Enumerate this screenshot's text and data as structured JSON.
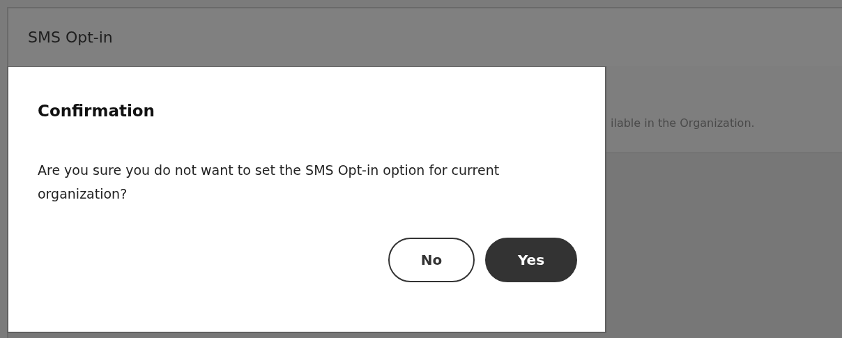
{
  "page": {
    "title": "SMS Opt-in",
    "description": "ilable in the Organization."
  },
  "dialog": {
    "title": "Confirmation",
    "message": "Are you sure you do not want to set the SMS Opt-in option for current organization?",
    "buttons": [
      {
        "label": "No",
        "kind": "secondary"
      },
      {
        "label": "Yes",
        "kind": "primary"
      }
    ]
  }
}
